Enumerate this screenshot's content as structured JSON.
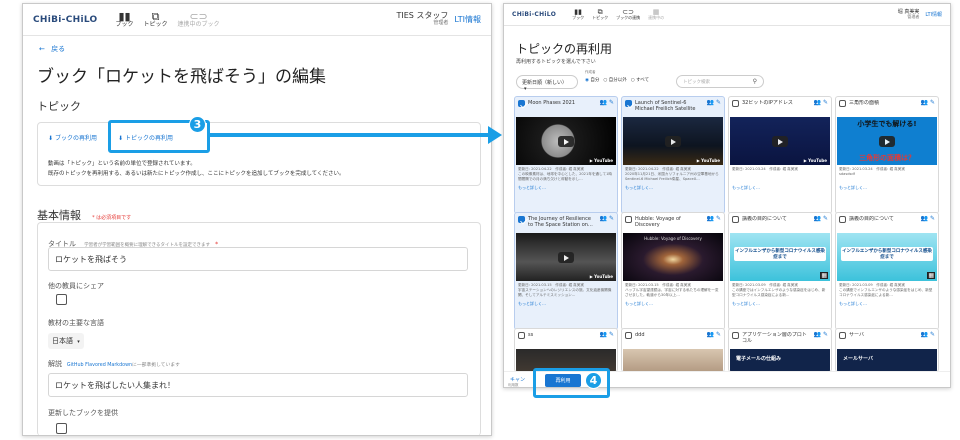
{
  "left": {
    "header": {
      "logo": "CHiBi-CHiLO",
      "nav": [
        {
          "icon": "book-icon",
          "label": "ブック"
        },
        {
          "icon": "topic-icon",
          "label": "トピック"
        },
        {
          "icon": "link-icon",
          "label": "連携中のブック"
        }
      ],
      "user_name": "TIES スタッフ",
      "user_role": "管理者",
      "lti": "LTI情報"
    },
    "back": "戻る",
    "title": "ブック「ロケットを飛ばそう」の編集",
    "topic_heading": "トピック",
    "reuse_book": "ブックの再利用",
    "reuse_topic": "トピックの再利用",
    "help_line1": "動画は「トピック」という名前の単位で登録されています。",
    "help_line2": "既存のトピックを再利用する、あるいは新たにトピック作成し、ここにトピックを追加してブックを完成してください。",
    "basic_heading": "基本情報",
    "required_note": "* は必須項目です",
    "title_label": "タイトル",
    "title_hint": "学習者が学習範囲を概要に理解できるタイトルを設定できます",
    "title_value": "ロケットを飛ばそう",
    "share_label": "他の教員にシェア",
    "lang_label": "教材の主要な言語",
    "lang_value": "日本語",
    "desc_label": "解説",
    "desc_hint_link": "GitHub Flavored Markdown",
    "desc_hint_rest": "に一部準拠しています",
    "desc_value": "ロケットを飛ばしたい人集まれ！",
    "update_label": "更新したブックを提供"
  },
  "right": {
    "header": {
      "logo": "CHiBi-CHiLO",
      "nav": [
        {
          "icon": "book-icon",
          "label": "ブック"
        },
        {
          "icon": "topic-icon",
          "label": "トピック"
        },
        {
          "icon": "link-icon",
          "label": "ブックの連携"
        },
        {
          "icon": "grid-icon",
          "label": "連携中の"
        }
      ],
      "user_name": "堀 真美実",
      "user_role": "管理者",
      "lti": "LTI情報"
    },
    "title": "トピックの再利用",
    "subtitle": "再利用するトピックを選んで下さい",
    "sort_value": "更新日順（新しい）",
    "author_label": "作成者",
    "author_options": [
      "自分",
      "自分以外",
      "すべて"
    ],
    "search_placeholder": "トピック検索",
    "cards": [
      {
        "title": "Moon Phases 2021",
        "checked": true,
        "meta": "更新日: 2021.04.22　作成者: 堀 真美実",
        "desc": "この映像素材は、地球を中心とした、2021年を通して1時間間隔での月の満ち欠けと秤動を示し…",
        "more": "もっと詳しく…",
        "thumb": "moon"
      },
      {
        "title": "Launch of Sentinel-6 Michael Freilich Satellite",
        "checked": true,
        "meta": "更新日: 2021.04.22　作成者: 堀 真美実",
        "desc": "2020年11月21日、米国カリフォルニア州の空軍基地からSentinel-6 Michael Freilich衛星、SpaceX…",
        "more": "もっと詳しく…",
        "thumb": "launch"
      },
      {
        "title": "32ビットのIPアドレス",
        "checked": false,
        "meta": "更新日: 2021.03.24　作成者: 堀 真美実",
        "desc": "",
        "more": "もっと詳しく…",
        "thumb": "ip"
      },
      {
        "title": "三角形の面積",
        "checked": false,
        "meta": "更新日: 2021.03.24　作成者: 堀 真美実",
        "desc": "sdasdsdf",
        "more": "もっと詳しく…",
        "thumb": "triangle",
        "thumb_top": "小学生でも解ける!",
        "thumb_bottom": "三角形の面積は？"
      },
      {
        "title": "The Journey of Resilience to The Space Station on…",
        "checked": true,
        "meta": "更新日: 2021.03.15　作成者: 堀 真美実",
        "desc": "宇宙ステーションへのレジリエンスの旅。文化遺産機関機関、そしてアルテミスミッション…",
        "more": "もっと詳しく…",
        "thumb": "astronaut"
      },
      {
        "title": "Hubble: Voyage of Discovery",
        "checked": false,
        "meta": "更新日: 2021.03.15　作成者: 堀 真美実",
        "desc": "ハッブル宇宙望遠鏡は、宇宙に対する私たちの理解を一変させました。軌道から30年以上…",
        "more": "もっと詳しく…",
        "thumb": "galaxy",
        "thumb_text": "Hubble: Voyage of Discovery"
      },
      {
        "title": "講義の目的について",
        "checked": false,
        "meta": "更新日: 2021.03.09　作成者: 堀 真美実",
        "desc": "この講座ではインフルエンザのような感染症をはじめ、新型コロナウイルス感染症による新…",
        "more": "もっと詳しく…",
        "thumb": "lecture",
        "thumb_text": "インフルエンザから新型コロナウイルス感染症まで"
      },
      {
        "title": "講義の目的について",
        "checked": false,
        "meta": "更新日: 2021.03.09　作成者: 堀 真美実",
        "desc": "この講座でインフルエンザのような感染症をはじめ、新型コロナウイルス感染症による新…",
        "more": "もっと詳しく…",
        "thumb": "lecture",
        "thumb_text": "インフルエンザから新型コロナウイルス感染症まで"
      },
      {
        "title": "ss",
        "checked": false,
        "thumb": "dark"
      },
      {
        "title": "ddd",
        "checked": false,
        "thumb": "hands"
      },
      {
        "title": "アプリケーション層のプロトコル",
        "checked": false,
        "thumb": "mail",
        "thumb_text": "電子メールの仕組み"
      },
      {
        "title": "サーバ",
        "checked": false,
        "thumb": "server",
        "thumb_text": "メールサーバ"
      }
    ],
    "cancel": "キャン",
    "reuse_button": "再利用",
    "footer_note": "利用数"
  },
  "badges": {
    "step3": "3",
    "step4": "4"
  },
  "colors": {
    "accent": "#1976d2",
    "callout": "#1a9ee6",
    "required": "#e53935",
    "selected_card": "#e8f0fb"
  }
}
